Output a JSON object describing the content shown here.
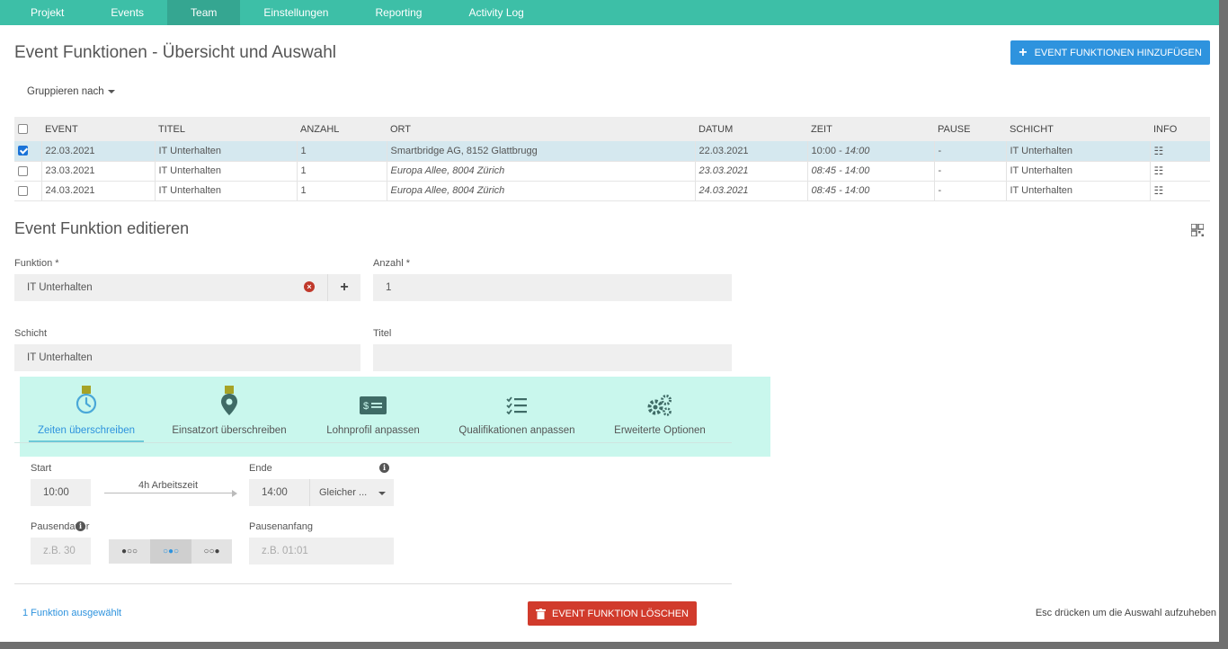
{
  "nav": {
    "tabs": [
      "Projekt",
      "Events",
      "Team",
      "Einstellungen",
      "Reporting",
      "Activity Log"
    ],
    "active": "Team"
  },
  "page": {
    "title": "Event Funktionen - Übersicht und Auswahl",
    "add_button": "EVENT FUNKTIONEN HINZUFÜGEN",
    "group_by": "Gruppieren nach"
  },
  "table": {
    "columns": [
      "EVENT",
      "TITEL",
      "ANZAHL",
      "ORT",
      "DATUM",
      "ZEIT",
      "PAUSE",
      "SCHICHT",
      "INFO"
    ],
    "rows": [
      {
        "event": "22.03.2021",
        "titel": "IT Unterhalten",
        "anzahl": "1",
        "ort": "Smartbridge AG, 8152 Glattbrugg",
        "datum": "22.03.2021",
        "zeit_start": "10:00 - ",
        "zeit_end": "14:00",
        "pause": "-",
        "schicht": "IT Unterhalten",
        "selected": true
      },
      {
        "event": "23.03.2021",
        "titel": "IT Unterhalten",
        "anzahl": "1",
        "ort": "Europa Allee, 8004 Zürich",
        "datum": "23.03.2021",
        "zeit_start": "08:45 - 14:00",
        "zeit_end": "",
        "pause": "-",
        "schicht": "IT Unterhalten",
        "selected": false
      },
      {
        "event": "24.03.2021",
        "titel": "IT Unterhalten",
        "anzahl": "1",
        "ort": "Europa Allee, 8004 Zürich",
        "datum": "24.03.2021",
        "zeit_start": "08:45 - 14:00",
        "zeit_end": "",
        "pause": "-",
        "schicht": "IT Unterhalten",
        "selected": false
      }
    ]
  },
  "editor": {
    "title": "Event Funktion editieren",
    "funktion_label": "Funktion *",
    "funktion_value": "IT Unterhalten",
    "anzahl_label": "Anzahl *",
    "anzahl_value": "1",
    "schicht_label": "Schicht",
    "schicht_value": "IT Unterhalten",
    "titel_label": "Titel",
    "titel_value": ""
  },
  "subtabs": [
    {
      "label": "Zeiten überschreiben",
      "icon": "clock-icon",
      "active": true
    },
    {
      "label": "Einsatzort überschreiben",
      "icon": "location-pin-icon",
      "active": false
    },
    {
      "label": "Lohnprofil anpassen",
      "icon": "money-icon",
      "active": false
    },
    {
      "label": "Qualifikationen anpassen",
      "icon": "checklist-icon",
      "active": false
    },
    {
      "label": "Erweiterte Optionen",
      "icon": "gears-icon",
      "active": false
    }
  ],
  "times": {
    "start_label": "Start",
    "start_value": "10:00",
    "duration": "4h Arbeitszeit",
    "end_label": "Ende",
    "end_value": "14:00",
    "day_select": "Gleicher ...",
    "pause_label": "Pausendauer",
    "pause_placeholder": "z.B. 30",
    "pause_start_label": "Pausenanfang",
    "pause_start_placeholder": "z.B. 01:01",
    "segments": [
      "●○○",
      "○●○",
      "○○●"
    ]
  },
  "footer": {
    "selected_info": "1 Funktion ausgewählt",
    "delete_button": "EVENT FUNKTION LÖSCHEN",
    "esc_hint": "Esc drücken um die Auswahl aufzuheben"
  },
  "colors": {
    "nav": "#3dbfa7",
    "primary": "#2e93de",
    "danger": "#d13b2c",
    "tabs_bg": "#c9f7ed"
  }
}
